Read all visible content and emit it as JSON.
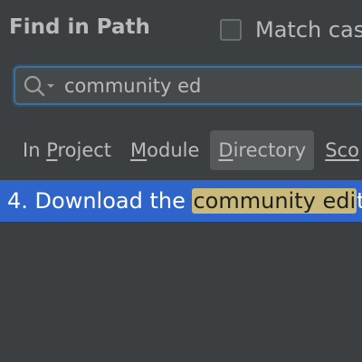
{
  "dialog": {
    "title": "Find in Path",
    "match_case_label": "Match cas"
  },
  "search": {
    "value": "community ed",
    "icon": "search-icon"
  },
  "scope_tabs": [
    {
      "before": "In ",
      "mnemonic": "P",
      "after": "roject",
      "active": false
    },
    {
      "before": "",
      "mnemonic": "M",
      "after": "odule",
      "active": false
    },
    {
      "before": "",
      "mnemonic": "D",
      "after": "irectory",
      "active": true
    },
    {
      "before": "",
      "mnemonic": "Sco",
      "after": "",
      "active": false
    }
  ],
  "results": [
    {
      "prefix": "4. Download the ",
      "match": "community edi",
      "suffix": "t"
    }
  ],
  "colors": {
    "background": "#3c3f41",
    "selection": "#2f65ca",
    "highlight": "#c9ba7b",
    "focus_border": "#466d94"
  }
}
